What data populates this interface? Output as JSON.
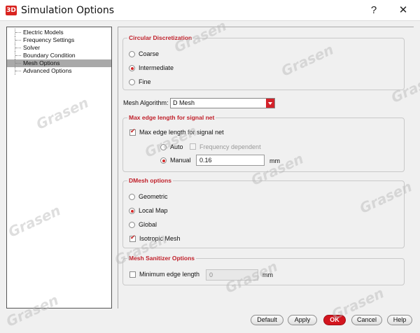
{
  "window": {
    "icon_text": "3D",
    "title": "Simulation Options",
    "help_glyph": "?",
    "close_glyph": "✕"
  },
  "tree": {
    "items": [
      {
        "label": "Electric Models",
        "selected": false
      },
      {
        "label": "Frequency Settings",
        "selected": false
      },
      {
        "label": "Solver",
        "selected": false
      },
      {
        "label": "Boundary Condition",
        "selected": false
      },
      {
        "label": "Mesh Options",
        "selected": true
      },
      {
        "label": "Advanced Options",
        "selected": false
      }
    ]
  },
  "circular_discretization": {
    "title": "Circular Discretization",
    "options": [
      "Coarse",
      "Intermediate",
      "Fine"
    ],
    "selected": "Intermediate"
  },
  "mesh_algorithm": {
    "label": "Mesh Algorithm:",
    "value": "D Mesh"
  },
  "max_edge": {
    "title": "Max edge length for signal net",
    "checkbox_label": "Max edge length for signal net",
    "checked": true,
    "auto_label": "Auto",
    "frequency_dependent_label": "Frequency dependent",
    "frequency_dependent_checked": false,
    "manual_label": "Manual",
    "selected": "Manual",
    "manual_value": "0.16",
    "unit": "mm"
  },
  "dmesh": {
    "title": "DMesh options",
    "options": [
      "Geometric",
      "Local Map",
      "Global"
    ],
    "selected": "Local Map",
    "isotropic_label": "Isotropic Mesh",
    "isotropic_checked": true
  },
  "mesh_sanitizer": {
    "title": "Mesh Sanitizer Options",
    "checkbox_label": "Minimum edge length",
    "checked": false,
    "value": "0",
    "unit": "mm"
  },
  "buttons": {
    "default": "Default",
    "apply": "Apply",
    "ok": "OK",
    "cancel": "Cancel",
    "help": "Help"
  },
  "watermark": "Grasen",
  "colors": {
    "accent_red": "#d3151e",
    "group_title_red": "#c0202a",
    "tree_selection": "#a9a9a9"
  }
}
